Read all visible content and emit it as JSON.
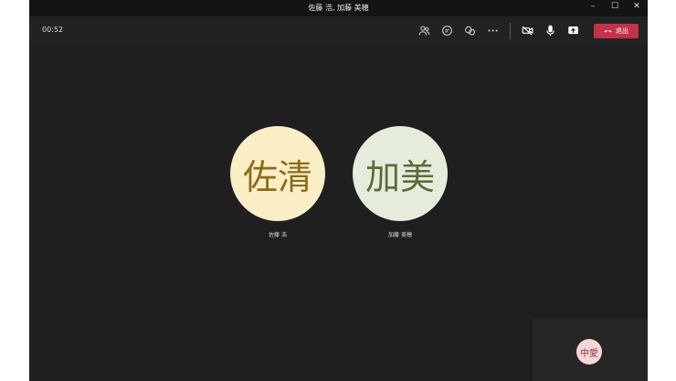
{
  "window": {
    "title": "佐藤 浩, 加藤 美穂",
    "controls": {
      "minimize": "–",
      "maximize": "☐",
      "close": "✕"
    }
  },
  "toolbar": {
    "timer": "00:52",
    "icons": [
      "participants-icon",
      "chat-icon",
      "reactions-icon",
      "more-icon",
      "camera-off-icon",
      "mic-icon",
      "share-icon"
    ],
    "leave_label": "退出",
    "leave_color": "#c4314b"
  },
  "participants": [
    {
      "initials": "佐清",
      "name": "佐藤 浩",
      "bg": "#fbeec7",
      "fg": "#8a6d1a"
    },
    {
      "initials": "加美",
      "name": "加藤 美穂",
      "bg": "#e6ecdc",
      "fg": "#5d6b3b"
    }
  ],
  "self": {
    "initials": "中愛",
    "bg": "#f5d6d8"
  }
}
